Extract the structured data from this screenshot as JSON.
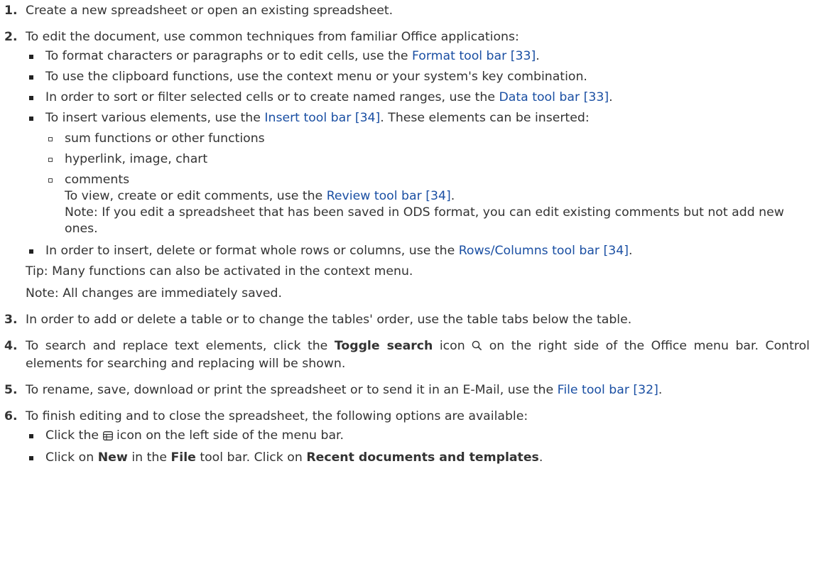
{
  "steps": [
    {
      "num": "1.",
      "text": "Create a new spreadsheet or open an existing spreadsheet."
    },
    {
      "num": "2.",
      "text": "To edit the document, use common techniques from familiar Office applications:",
      "bullets": [
        {
          "pre": "To format characters or paragraphs or to edit cells, use the ",
          "link": "Format tool bar [33]",
          "post": "."
        },
        {
          "pre": "To use the clipboard functions, use the context menu or your system's key combination.",
          "link": "",
          "post": ""
        },
        {
          "pre": "In order to sort or filter selected cells or to create named ranges, use the ",
          "link": "Data tool bar [33]",
          "post": "."
        },
        {
          "pre": "To insert various elements, use the ",
          "link": "Insert tool bar [34]",
          "post": ". These elements can be inserted:"
        },
        {
          "pre": "In order to insert, delete or format whole rows or columns, use the ",
          "link": "Rows/Columns tool bar [34]",
          "post": "."
        }
      ],
      "sub_bullets": [
        "sum functions or other functions",
        "hyperlink, image, chart",
        "comments"
      ],
      "comments_line2_pre": "To view, create or edit comments, use the ",
      "comments_line2_link": "Review tool bar [34]",
      "comments_line2_post": ".",
      "comments_note": "Note: If you edit a spreadsheet that has been saved in ODS format, you can edit existing comments but not add new ones.",
      "tip": "Tip: Many functions can also be activated in the context menu.",
      "note": "Note: All changes are immediately saved."
    },
    {
      "num": "3.",
      "text": "In order to add or delete a table or to change the tables' order, use the table tabs below the table."
    },
    {
      "num": "4.",
      "pre": "To search and replace text elements, click the ",
      "bold": "Toggle search",
      "mid": " icon ",
      "post": " on the right side of the Office menu bar. Control elements for searching and replacing will be shown.",
      "icon": "search-icon"
    },
    {
      "num": "5.",
      "pre": "To rename, save, download or print the spreadsheet or to send it in an E-Mail, use the ",
      "link": "File tool bar [32]",
      "post": "."
    },
    {
      "num": "6.",
      "text": "To finish editing and to close the spreadsheet, the following options are available:",
      "b1_pre": "Click the ",
      "b1_post": " icon on the left side of the menu bar.",
      "b1_icon": "spreadsheet-icon",
      "b2_a": "Click on ",
      "b2_b": "New",
      "b2_c": " in the ",
      "b2_d": "File",
      "b2_e": " tool bar. Click on ",
      "b2_f": "Recent documents and templates",
      "b2_g": "."
    }
  ],
  "colors": {
    "text": "#333333",
    "link": "#1a4fa3"
  }
}
